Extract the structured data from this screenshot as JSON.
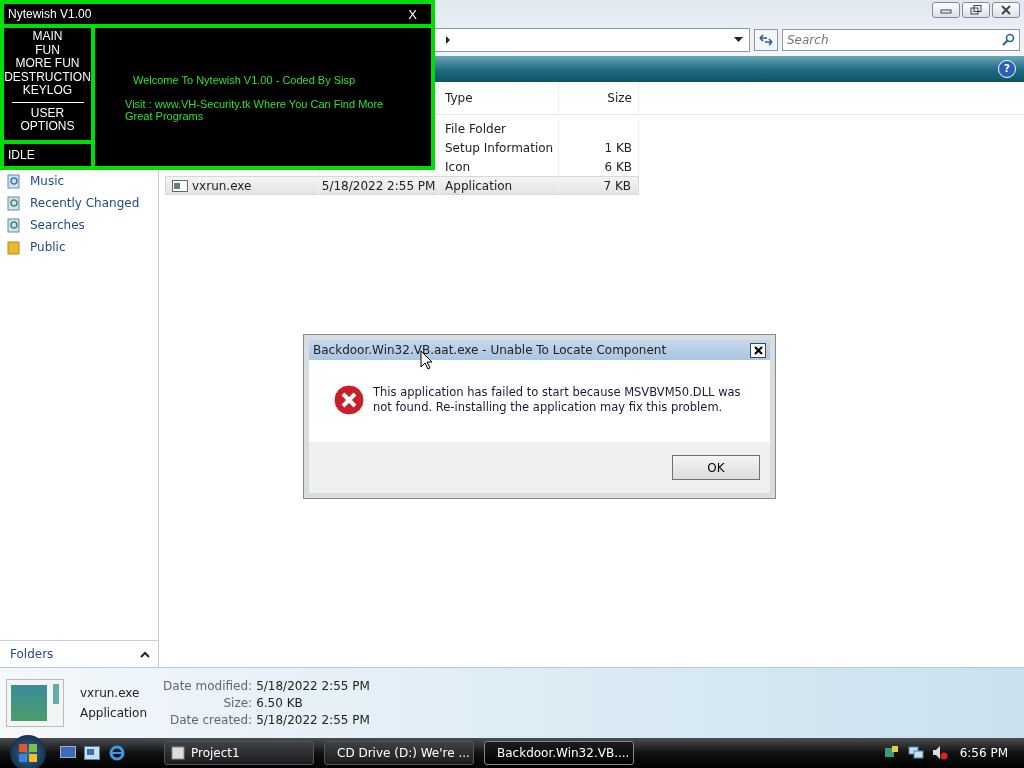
{
  "explorer": {
    "search": {
      "placeholder": "Search"
    },
    "help": "?",
    "sidebar": {
      "items": [
        {
          "label": "Music",
          "kind": "music"
        },
        {
          "label": "Recently Changed",
          "kind": "recent"
        },
        {
          "label": "Searches",
          "kind": "search"
        },
        {
          "label": "Public",
          "kind": "folder"
        }
      ],
      "folders_label": "Folders"
    },
    "table": {
      "columns": [
        "Type",
        "Size"
      ],
      "rows": [
        {
          "type": "File Folder",
          "selected": false
        },
        {
          "type": "Setup Information",
          "size": "1 KB",
          "selected": false
        },
        {
          "type": "Icon",
          "size": "6 KB",
          "selected": false
        },
        {
          "name": "vxrun.exe",
          "date_modified": "5/18/2022 2:55 PM",
          "type": "Application",
          "size": "7 KB",
          "selected": true
        }
      ]
    },
    "details": {
      "name": "vxrun.exe",
      "type": "Application",
      "fields": [
        {
          "label": "Date modified:",
          "value": "5/18/2022 2:55 PM"
        },
        {
          "label": "Size:",
          "value": "6.50 KB"
        },
        {
          "label": "Date created:",
          "value": "5/18/2022 2:55 PM"
        }
      ]
    }
  },
  "nytewish": {
    "title": "Nytewish V1.00",
    "close": "X",
    "menu": [
      {
        "label": "MAIN",
        "kind": "item"
      },
      {
        "label": "FUN",
        "kind": "item"
      },
      {
        "label": "MORE FUN",
        "kind": "item"
      },
      {
        "label": "DESTRUCTION",
        "kind": "item"
      },
      {
        "label": "KEYLOG",
        "kind": "item"
      },
      {
        "kind": "separator"
      },
      {
        "label": "USER",
        "kind": "item"
      },
      {
        "label": "OPTIONS",
        "kind": "item"
      }
    ],
    "status": "IDLE",
    "welcome": "Welcome To Nytewish V1.00 - Coded By Sisp",
    "visit": "Visit : www.VH-Security.tk Where You Can Find More Great Programs"
  },
  "dialog": {
    "title": "Backdoor.Win32.VB.aat.exe - Unable To Locate Component",
    "message": "This application has failed to start because MSVBVM50.DLL was not found. Re-installing the application may fix this problem.",
    "buttons": [
      "OK"
    ]
  },
  "taskbar": {
    "tasks": [
      {
        "label": "Project1",
        "selected": false
      },
      {
        "label": "CD Drive (D:) We're ...",
        "selected": false
      },
      {
        "label": "Backdoor.Win32.VB....",
        "selected": true
      }
    ],
    "clock": "6:56 PM"
  }
}
